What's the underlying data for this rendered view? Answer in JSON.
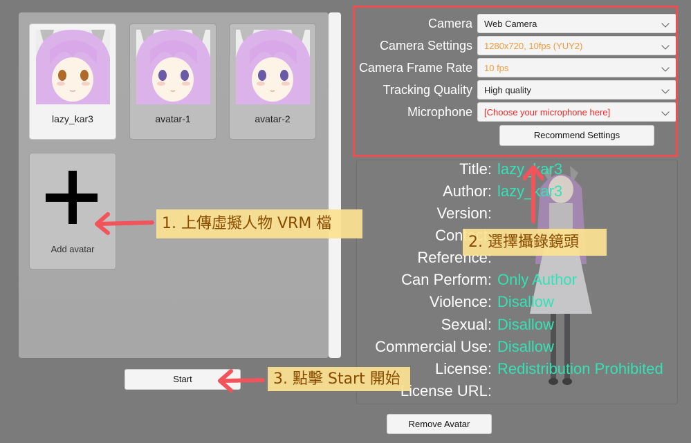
{
  "avatars": [
    {
      "name": "lazy_kar3",
      "selected": true,
      "eye_color": "#b06a2a"
    },
    {
      "name": "avatar-1",
      "selected": false,
      "eye_color": "#6b5aa8"
    },
    {
      "name": "avatar-2",
      "selected": false,
      "eye_color": "#6b5aa8"
    }
  ],
  "add_avatar": {
    "label": "Add avatar",
    "icon": "plus-icon"
  },
  "buttons": {
    "start": "Start",
    "remove_avatar": "Remove Avatar",
    "recommend_settings": "Recommend Settings"
  },
  "settings": [
    {
      "label": "Camera",
      "value": "Web Camera",
      "state": "normal"
    },
    {
      "label": "Camera Settings",
      "value": "1280x720, 10fps (YUY2)",
      "state": "warn"
    },
    {
      "label": "Camera Frame Rate",
      "value": "10 fps",
      "state": "warn"
    },
    {
      "label": "Tracking Quality",
      "value": "High quality",
      "state": "normal"
    },
    {
      "label": "Microphone",
      "value": "[Choose your microphone here]",
      "state": "error"
    }
  ],
  "metadata": [
    {
      "label": "Title:",
      "value": "lazy_kar3"
    },
    {
      "label": "Author:",
      "value": "lazy_kar3"
    },
    {
      "label": "Version:",
      "value": ""
    },
    {
      "label": "Contact:",
      "value": ""
    },
    {
      "label": "Reference:",
      "value": ""
    },
    {
      "label": "Can Perform:",
      "value": "Only Author"
    },
    {
      "label": "Violence:",
      "value": "Disallow"
    },
    {
      "label": "Sexual:",
      "value": "Disallow"
    },
    {
      "label": "Commercial Use:",
      "value": "Disallow"
    },
    {
      "label": "License:",
      "value": "Redistribution Prohibited"
    },
    {
      "label": "License URL:",
      "value": ""
    }
  ],
  "annotations": {
    "step1": "1. 上傳虛擬人物 VRM 檔",
    "step2": "2. 選擇攝錄鏡頭",
    "step3": "3. 點擊 Start 開始"
  },
  "colors": {
    "background": "#7b7b7b",
    "highlight_border": "#ef4d4f",
    "metadata_value": "#33e2b4",
    "warn_text": "#f59a3a",
    "error_text": "#ee2a2a",
    "callout_bg": "#fde293",
    "callout_text": "#8a4a00",
    "arrow": "#f2545b"
  }
}
